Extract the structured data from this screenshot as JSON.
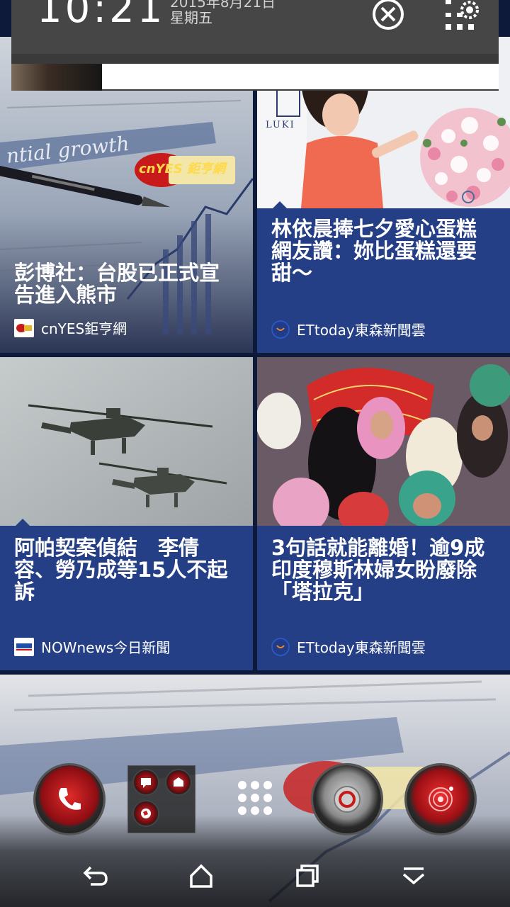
{
  "status": {
    "time": "10:21",
    "date": "2015年8月21日",
    "weekday": "星期五",
    "close_icon": "close-circle-icon",
    "settings_icon": "settings-grid-icon"
  },
  "tiles": [
    {
      "headline": "彭博社：台股已正式宣告進入熊市",
      "source": "cnYES鉅亨網",
      "watermark_brand": "cnYES 鉅亨網",
      "watermark_word": "ntial growth"
    },
    {
      "headline": "林依晨捧七夕愛心蛋糕　網友讚：妳比蛋糕還要甜～",
      "source": "ETtoday東森新聞雲"
    },
    {
      "headline": "阿帕契案偵結　李倩容、勞乃成等15人不起訴",
      "source": "NOWnews今日新聞"
    },
    {
      "headline": "3句話就能離婚！逾9成印度穆斯林婦女盼廢除「塔拉克」",
      "source": "ETtoday東森新聞雲"
    }
  ],
  "dock": {
    "icons": [
      "phone-icon",
      "messages-folder-icon",
      "app-drawer-icon",
      "browser-icon",
      "camera-icon"
    ]
  },
  "nav": {
    "icons": [
      "back-icon",
      "home-icon",
      "recent-apps-icon",
      "collapse-icon"
    ]
  },
  "colors": {
    "tile_panel": "#253f86",
    "status_bg": "#464646",
    "accent_red": "#d4141c"
  }
}
